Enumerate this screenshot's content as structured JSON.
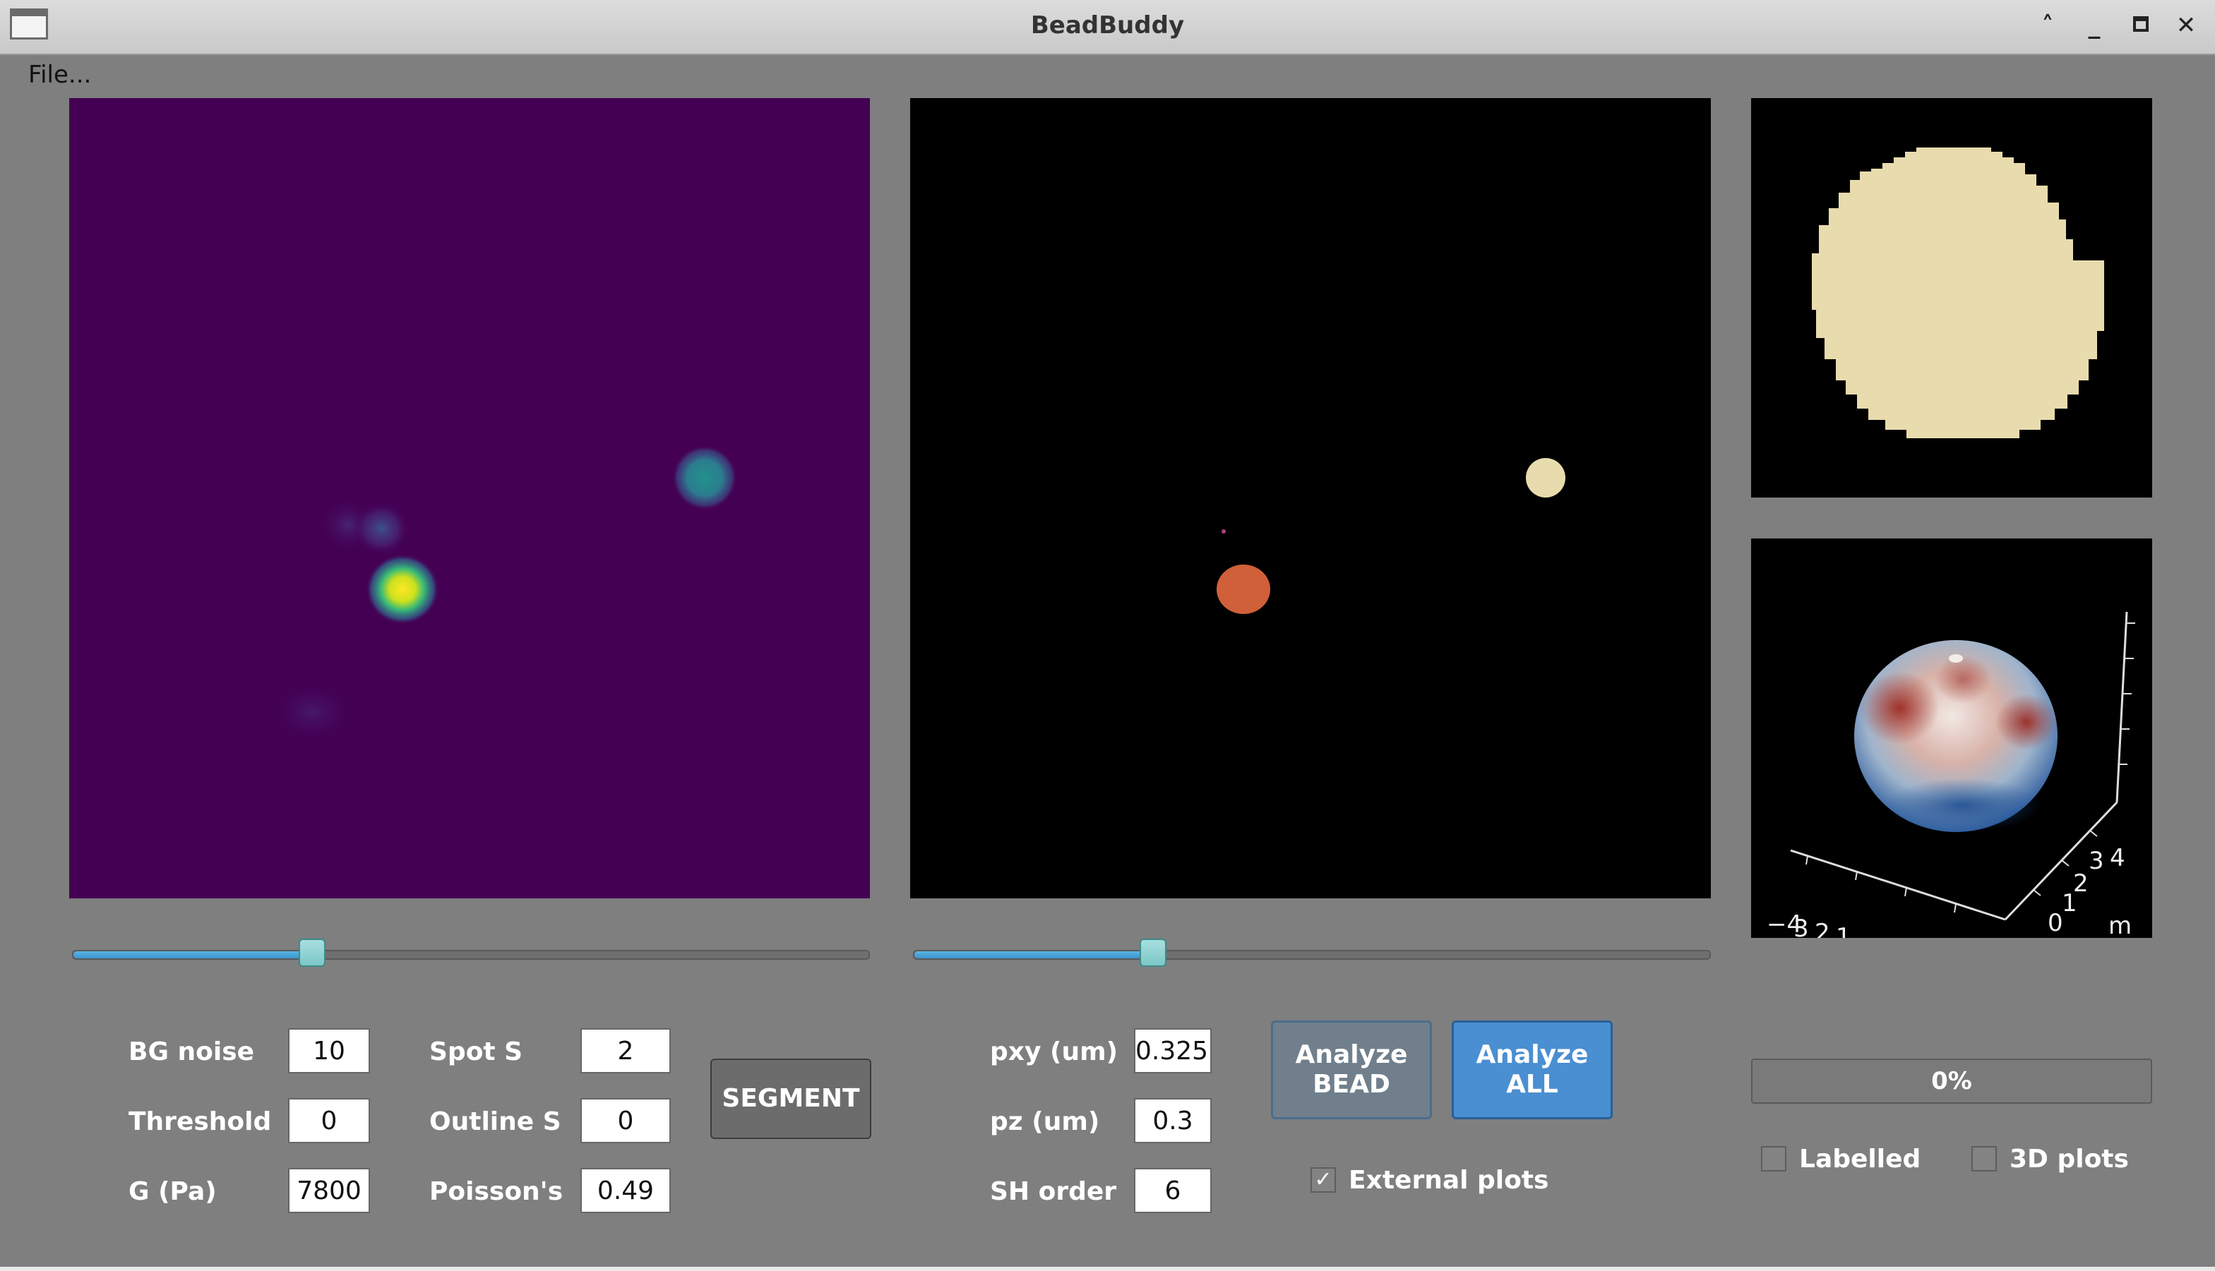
{
  "window": {
    "title": "BeadBuddy",
    "controls": [
      "chevron-up-icon",
      "minimize-icon",
      "maximize-icon",
      "close-icon"
    ]
  },
  "menu": {
    "file": "File..."
  },
  "sliders": {
    "left": {
      "value": 0.3
    },
    "right": {
      "value": 0.3
    }
  },
  "params": {
    "bg_noise": {
      "label": "BG noise",
      "value": "10"
    },
    "threshold": {
      "label": "Threshold",
      "value": "0"
    },
    "g_pa": {
      "label": "G (Pa)",
      "value": "7800"
    },
    "spot_s": {
      "label": "Spot S",
      "value": "2"
    },
    "outline_s": {
      "label": "Outline S",
      "value": "0"
    },
    "poissons": {
      "label": "Poisson's",
      "value": "0.49"
    },
    "pxy": {
      "label": "pxy (um)",
      "value": "0.325"
    },
    "pz": {
      "label": "pz (um)",
      "value": "0.3"
    },
    "sh_order": {
      "label": "SH order",
      "value": "6"
    }
  },
  "buttons": {
    "segment": "SEGMENT",
    "analyze_bead": "Analyze\nBEAD",
    "analyze_all": "Analyze\nALL"
  },
  "checkboxes": {
    "external_plots": {
      "label": "External plots",
      "checked": true
    },
    "labelled": {
      "label": "Labelled",
      "checked": false
    },
    "plots_3d": {
      "label": "3D plots",
      "checked": false
    }
  },
  "progress": {
    "value": 0,
    "text": "0%"
  },
  "plot3d_ticks": [
    "−4",
    "3",
    "2",
    "1",
    "3",
    "4",
    "2",
    "1",
    "0",
    "m"
  ],
  "colors": {
    "viridis_bg": "#440154",
    "label_bead_orange": "#d0603a",
    "label_bead_beige": "#e8dcae",
    "accent_blue": "#4a8fd1"
  }
}
